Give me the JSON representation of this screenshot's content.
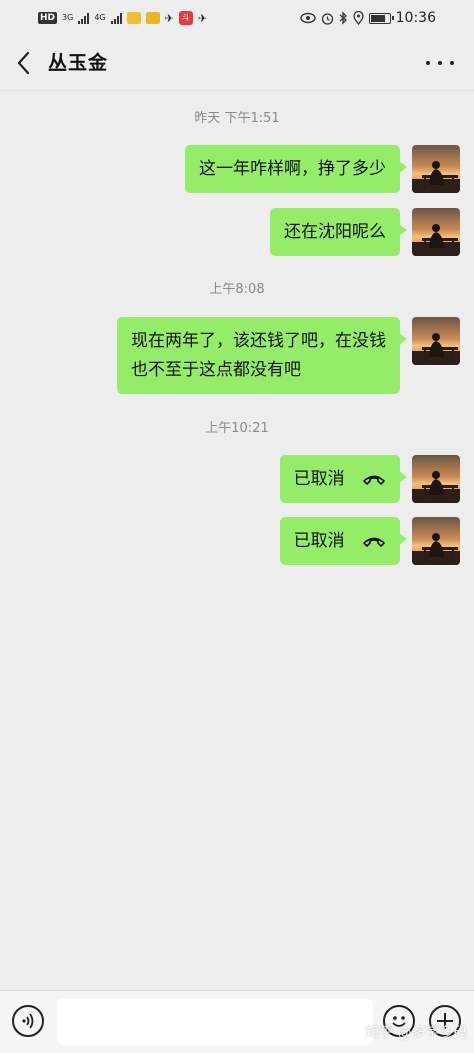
{
  "status_bar": {
    "hd": "HD",
    "net1": "3G",
    "net2": "4G",
    "clock": "10:36",
    "app_badge": "斗"
  },
  "header": {
    "title": "丛玉金"
  },
  "messages": [
    {
      "timestamp": "昨天 下午1:51"
    },
    {
      "text": "这一年咋样啊，挣了多少"
    },
    {
      "text": "还在沈阳呢么"
    },
    {
      "timestamp": "上午8:08"
    },
    {
      "text_line1": "现在两年了，该还钱了吧，在没钱",
      "text_line2": "也不至于这点都没有吧"
    },
    {
      "timestamp": "上午10:21"
    },
    {
      "text": "已取消"
    },
    {
      "text": "已取消"
    }
  ],
  "colors": {
    "bubble": "#95ec69",
    "background": "#ededed"
  },
  "input": {
    "value": "",
    "placeholder": ""
  },
  "watermark": "知乎 @多字多码"
}
